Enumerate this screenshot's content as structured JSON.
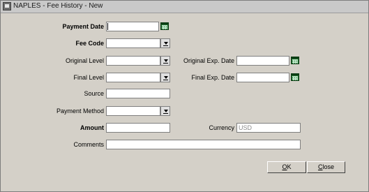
{
  "window": {
    "title": "NAPLES - Fee History - New"
  },
  "form": {
    "payment_date": {
      "label": "Payment Date",
      "value": ""
    },
    "fee_code": {
      "label": "Fee Code",
      "value": ""
    },
    "original_level": {
      "label": "Original Level",
      "value": ""
    },
    "original_exp_date": {
      "label": "Original Exp. Date",
      "value": ""
    },
    "final_level": {
      "label": "Final Level",
      "value": ""
    },
    "final_exp_date": {
      "label": "Final Exp. Date",
      "value": ""
    },
    "source": {
      "label": "Source",
      "value": ""
    },
    "payment_method": {
      "label": "Payment Method",
      "value": ""
    },
    "amount": {
      "label": "Amount",
      "value": ""
    },
    "currency": {
      "label": "Currency",
      "value": "USD"
    },
    "comments": {
      "label": "Comments",
      "value": ""
    }
  },
  "buttons": {
    "ok": {
      "mnemonic": "O",
      "rest": "K"
    },
    "close": {
      "mnemonic": "C",
      "rest": "lose"
    }
  },
  "icons": {
    "window": "app-window-icon",
    "calendar": "calendar-icon",
    "dropdown": "dropdown-arrow-icon"
  }
}
